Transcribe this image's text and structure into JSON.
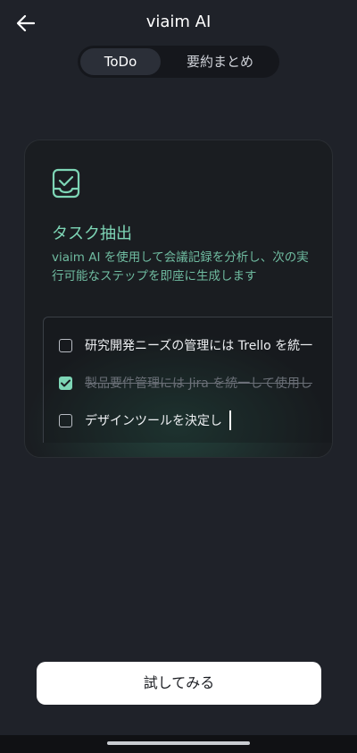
{
  "header": {
    "title": "viaim AI"
  },
  "tabs": [
    {
      "label": "ToDo",
      "active": true
    },
    {
      "label": "要約まとめ",
      "active": false
    }
  ],
  "card": {
    "icon": "task-check-icon",
    "title": "タスク抽出",
    "description": "viaim AI を使用して会議記録を分析し、次の実行可能なステップを即座に生成します",
    "todos": [
      {
        "text": "研究開発ニーズの管理には Trello を統一",
        "checked": false
      },
      {
        "text": "製品要件管理には Jira を統一して使用し",
        "checked": true
      },
      {
        "text": "デザインツールを決定し",
        "checked": false
      }
    ]
  },
  "cta": {
    "label": "試してみる"
  },
  "colors": {
    "accent": "#7ed6b6",
    "background": "#1f2229",
    "button": "#ffffff"
  }
}
